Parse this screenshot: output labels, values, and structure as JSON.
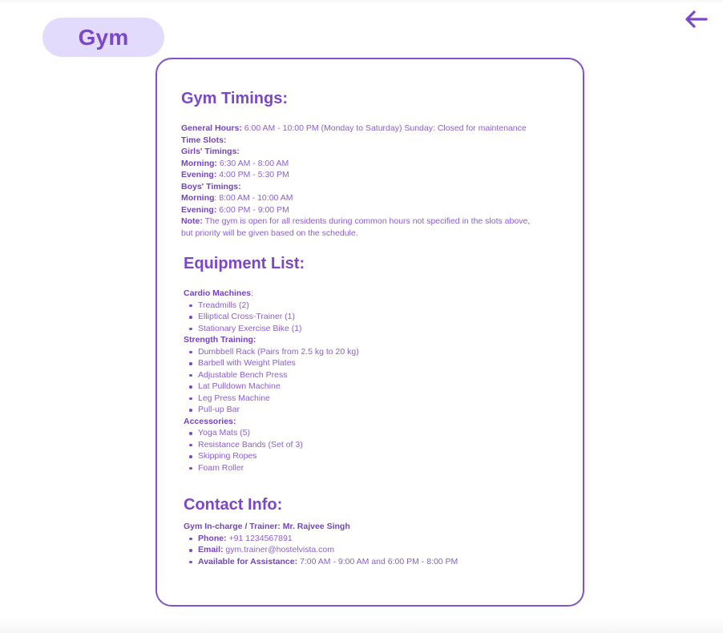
{
  "header": {
    "title": "Gym",
    "back_icon": "arrow-left-icon",
    "accent_color": "#7b47c8",
    "pill_color": "#e3dbfb"
  },
  "timings": {
    "heading": "Gym Timings:",
    "general_label": "General Hours:",
    "general_value": " 6:00 AM - 10:00 PM (Monday to Saturday) Sunday: Closed for maintenance",
    "slots_label": "Time Slots:",
    "girls_label": "Girls' Timings:",
    "girls_morning_label": "Morning:",
    "girls_morning_value": " 6:30 AM - 8:00 AM",
    "girls_evening_label": "Evening:",
    "girls_evening_value": " 4:00 PM - 5:30 PM",
    "boys_label": "Boys' Timings:",
    "boys_morning_label": "Morning",
    "boys_morning_value": ": 8:00 AM - 10:00 AM",
    "boys_evening_label": "Evening:",
    "boys_evening_value": " 6:00 PM - 9:00 PM",
    "note_label": "Note:",
    "note_value": " The gym is open for all residents during common hours not specified in the slots above, but priority will be given based on the schedule."
  },
  "equipment": {
    "heading": "Equipment List:",
    "cardio_label": "Cardio Machines",
    "cardio_suffix": ":",
    "cardio_items": [
      "Treadmills (2)",
      "Elliptical Cross-Trainer (1)",
      "Stationary Exercise Bike (1)"
    ],
    "strength_label": "Strength Training:",
    "strength_items": [
      "Dumbbell Rack (Pairs from 2.5 kg to 20 kg)",
      "Barbell with Weight Plates",
      "Adjustable Bench Press",
      "Lat Pulldown Machine",
      "Leg Press Machine",
      "Pull-up Bar"
    ],
    "accessories_label": "Accessories:",
    "accessories_items": [
      "Yoga Mats (5)",
      "Resistance Bands (Set of 3)",
      "Skipping Ropes",
      "Foam Roller"
    ]
  },
  "contact": {
    "heading": "Contact Info:",
    "incharge": "Gym In-charge / Trainer: Mr. Rajvee Singh",
    "phone_label": "Phone:",
    "phone_value": " +91 1234567891",
    "email_label": "Email:",
    "email_value": " gym.trainer@hostelvista.com",
    "avail_label": "Available for Assistance:",
    "avail_value": " 7:00 AM - 9:00 AM and 6:00 PM - 8:00 PM"
  }
}
